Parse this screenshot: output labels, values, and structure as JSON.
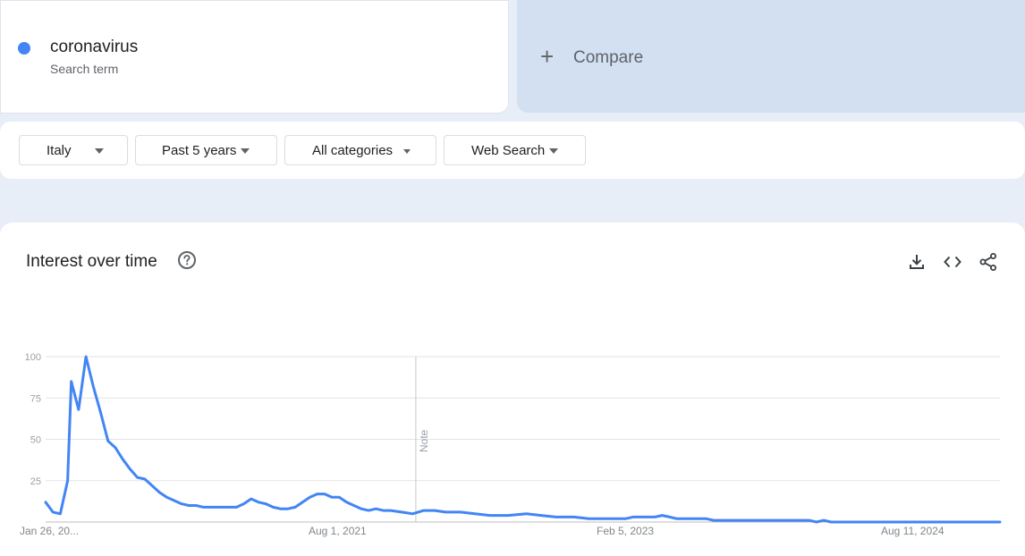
{
  "search_term": {
    "name": "coronavirus",
    "type": "Search term",
    "color": "#4285f4"
  },
  "compare": {
    "label": "Compare",
    "icon": "plus-icon"
  },
  "filters": {
    "region": "Italy",
    "time_range": "Past 5 years",
    "category": "All categories",
    "search_type": "Web Search"
  },
  "chart_section": {
    "title": "Interest over time",
    "help_icon": "help-circle-icon",
    "actions": [
      "download-icon",
      "embed-code-icon",
      "share-icon"
    ]
  },
  "chart_data": {
    "type": "line",
    "title": "Interest over time",
    "xlabel": "",
    "ylabel": "",
    "ylim": [
      0,
      100
    ],
    "y_ticks": [
      "25",
      "50",
      "75",
      "100"
    ],
    "x_tick_labels": [
      "Jan 26, 20...",
      "Aug 1, 2021",
      "Feb 5, 2023",
      "Aug 11, 2024"
    ],
    "x_range": [
      "2020-01-26",
      "2025-01-19"
    ],
    "grid": true,
    "note_marker": {
      "date": "2022-01-01",
      "label": "Note"
    },
    "series": [
      {
        "color": "#4285f4",
        "points": [
          [
            "2020-01-26",
            12
          ],
          [
            "2020-02-09",
            6
          ],
          [
            "2020-02-23",
            5
          ],
          [
            "2020-03-08",
            25
          ],
          [
            "2020-03-15",
            85
          ],
          [
            "2020-03-29",
            68
          ],
          [
            "2020-04-12",
            100
          ],
          [
            "2020-04-26",
            82
          ],
          [
            "2020-05-10",
            66
          ],
          [
            "2020-05-24",
            49
          ],
          [
            "2020-06-07",
            45
          ],
          [
            "2020-06-21",
            38
          ],
          [
            "2020-07-05",
            32
          ],
          [
            "2020-07-19",
            27
          ],
          [
            "2020-08-02",
            26
          ],
          [
            "2020-08-16",
            22
          ],
          [
            "2020-08-30",
            18
          ],
          [
            "2020-09-13",
            15
          ],
          [
            "2020-09-27",
            13
          ],
          [
            "2020-10-11",
            11
          ],
          [
            "2020-10-25",
            10
          ],
          [
            "2020-11-08",
            10
          ],
          [
            "2020-11-22",
            9
          ],
          [
            "2020-12-06",
            9
          ],
          [
            "2020-12-20",
            9
          ],
          [
            "2021-01-10",
            9
          ],
          [
            "2021-01-24",
            9
          ],
          [
            "2021-02-07",
            11
          ],
          [
            "2021-02-21",
            14
          ],
          [
            "2021-03-07",
            12
          ],
          [
            "2021-03-21",
            11
          ],
          [
            "2021-04-04",
            9
          ],
          [
            "2021-04-18",
            8
          ],
          [
            "2021-05-02",
            8
          ],
          [
            "2021-05-16",
            9
          ],
          [
            "2021-05-30",
            12
          ],
          [
            "2021-06-13",
            15
          ],
          [
            "2021-06-27",
            17
          ],
          [
            "2021-07-11",
            17
          ],
          [
            "2021-07-25",
            15
          ],
          [
            "2021-08-08",
            15
          ],
          [
            "2021-08-22",
            12
          ],
          [
            "2021-09-05",
            10
          ],
          [
            "2021-09-19",
            8
          ],
          [
            "2021-10-03",
            7
          ],
          [
            "2021-10-17",
            8
          ],
          [
            "2021-10-31",
            7
          ],
          [
            "2021-11-14",
            7
          ],
          [
            "2021-12-05",
            6
          ],
          [
            "2021-12-26",
            5
          ],
          [
            "2022-01-16",
            7
          ],
          [
            "2022-02-06",
            7
          ],
          [
            "2022-02-27",
            6
          ],
          [
            "2022-03-27",
            6
          ],
          [
            "2022-04-24",
            5
          ],
          [
            "2022-05-22",
            4
          ],
          [
            "2022-06-26",
            4
          ],
          [
            "2022-07-31",
            5
          ],
          [
            "2022-08-28",
            4
          ],
          [
            "2022-09-25",
            3
          ],
          [
            "2022-10-30",
            3
          ],
          [
            "2022-11-27",
            2
          ],
          [
            "2023-01-01",
            2
          ],
          [
            "2023-02-05",
            2
          ],
          [
            "2023-02-19",
            3
          ],
          [
            "2023-03-05",
            3
          ],
          [
            "2023-04-02",
            3
          ],
          [
            "2023-04-16",
            4
          ],
          [
            "2023-04-30",
            3
          ],
          [
            "2023-05-14",
            2
          ],
          [
            "2023-06-11",
            2
          ],
          [
            "2023-07-09",
            2
          ],
          [
            "2023-07-23",
            1
          ],
          [
            "2023-09-03",
            1
          ],
          [
            "2023-10-29",
            1
          ],
          [
            "2023-12-24",
            1
          ],
          [
            "2024-01-21",
            1
          ],
          [
            "2024-02-04",
            0
          ],
          [
            "2024-02-18",
            1
          ],
          [
            "2024-03-03",
            0
          ],
          [
            "2024-06-02",
            0
          ],
          [
            "2024-09-01",
            0
          ],
          [
            "2024-12-01",
            0
          ],
          [
            "2025-01-19",
            0
          ]
        ]
      }
    ]
  }
}
